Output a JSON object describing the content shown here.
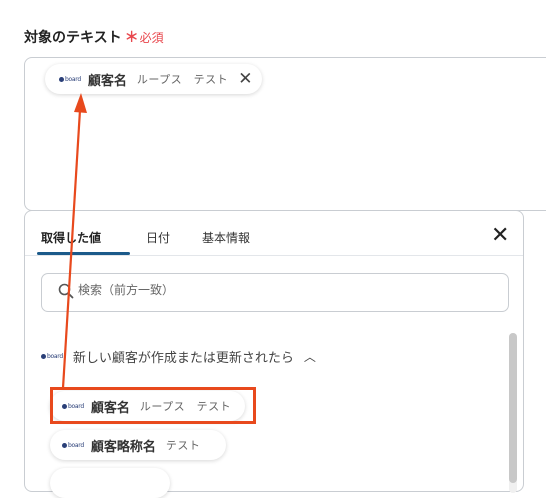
{
  "form": {
    "label": "対象のテキスト",
    "required_mark": "＊",
    "required_text": "必須"
  },
  "selected_chip": {
    "logo": "board",
    "name": "顧客名",
    "meta": "ループス　テスト",
    "remove_icon": "close-icon"
  },
  "picker": {
    "tabs": [
      {
        "label": "取得した値",
        "active": true
      },
      {
        "label": "日付",
        "active": false
      },
      {
        "label": "基本情報",
        "active": false
      }
    ],
    "close_icon": "close-icon",
    "search": {
      "placeholder": "検索（前方一致）",
      "value": ""
    },
    "group": {
      "logo": "board",
      "title": "新しい顧客が作成または更新されたら",
      "chevron": "chevron-up-icon"
    },
    "items": [
      {
        "logo": "board",
        "name": "顧客名",
        "meta": "ループス　テスト"
      },
      {
        "logo": "board",
        "name": "顧客略称名",
        "meta": "テスト"
      }
    ]
  },
  "colors": {
    "accent": "#1b5a8a",
    "required": "#e8474d",
    "annotation": "#e8491d"
  }
}
